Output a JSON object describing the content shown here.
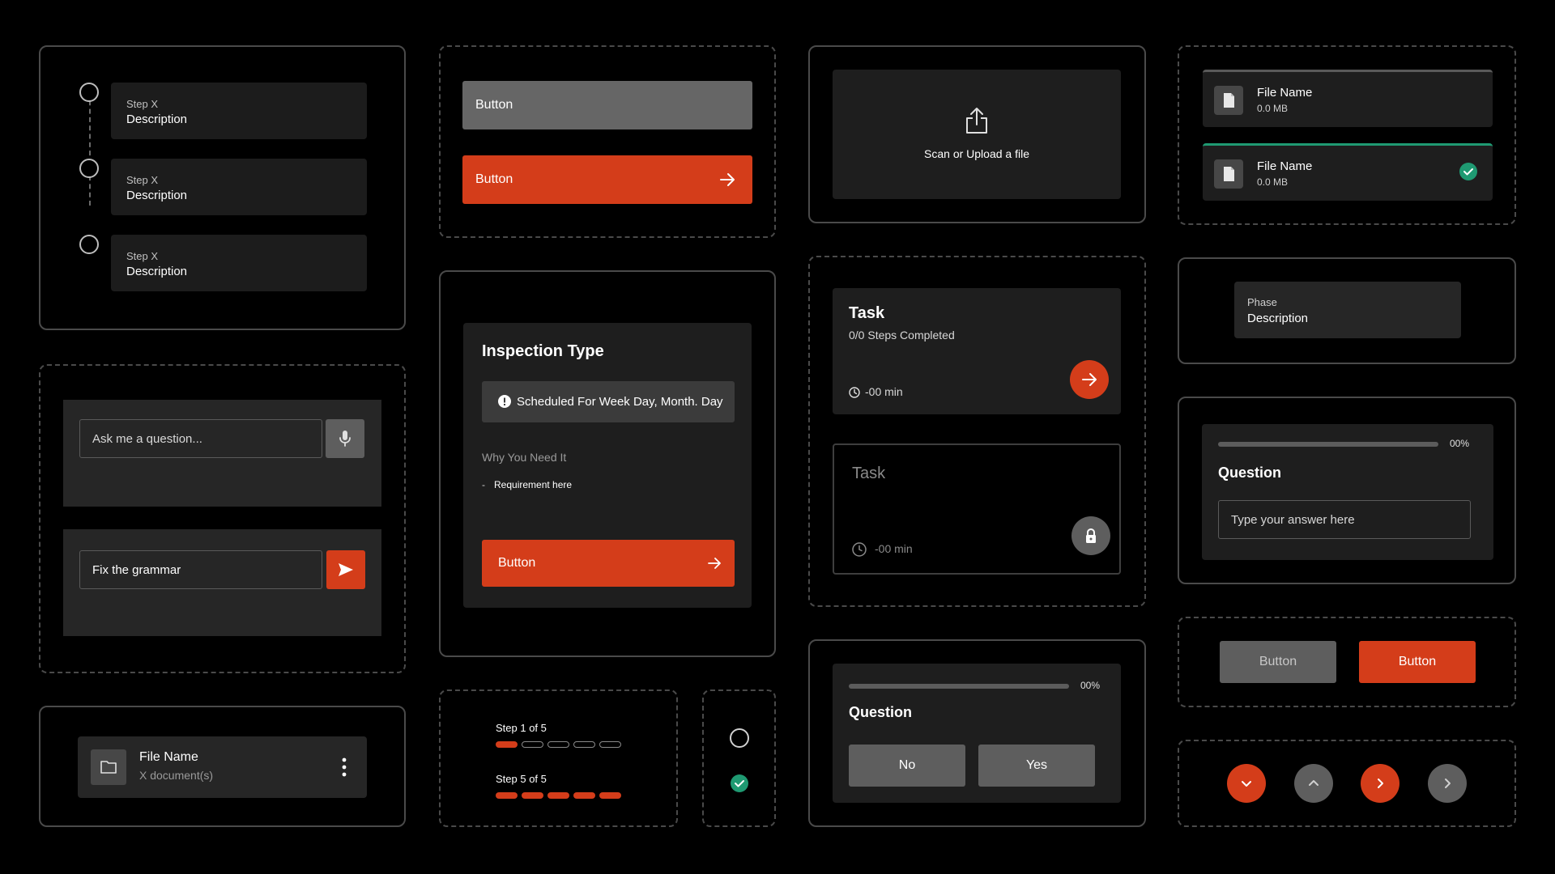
{
  "stepper": {
    "steps": [
      {
        "label": "Step X",
        "description": "Description"
      },
      {
        "label": "Step X",
        "description": "Description"
      },
      {
        "label": "Step X",
        "description": "Description"
      }
    ]
  },
  "buttons_top": {
    "disabled_label": "Button",
    "primary_label": "Button"
  },
  "upload": {
    "label": "Scan or Upload a file"
  },
  "files": [
    {
      "name": "File Name",
      "size": "0.0 MB"
    },
    {
      "name": "File Name",
      "size": "0.0 MB"
    }
  ],
  "chat": {
    "ask_placeholder": "Ask me a question...",
    "fix_value": "Fix the grammar"
  },
  "inspection": {
    "title": "Inspection Type",
    "scheduled": "Scheduled For Week Day, Month. Day",
    "why_label": "Why You Need It",
    "requirement_dash": "-",
    "requirement": "Requirement here",
    "button_label": "Button"
  },
  "task_active": {
    "title": "Task",
    "subtitle": "0/0 Steps Completed",
    "time": "-00 min"
  },
  "task_locked": {
    "title": "Task",
    "time": "-00 min"
  },
  "phase": {
    "label": "Phase",
    "description": "Description"
  },
  "question_text": {
    "progress_percent": 0,
    "progress_label": "00%",
    "title": "Question",
    "answer_placeholder": "Type your answer here"
  },
  "folder": {
    "name": "File Name",
    "count": "X document(s)"
  },
  "progress_steps": {
    "first": {
      "label": "Step 1 of 5",
      "done": 1,
      "total": 5
    },
    "second": {
      "label": "Step 5 of 5",
      "done": 5,
      "total": 5
    }
  },
  "question_yn": {
    "progress_percent": 0,
    "progress_label": "00%",
    "title": "Question",
    "no_label": "No",
    "yes_label": "Yes"
  },
  "button_pair": {
    "secondary_label": "Button",
    "primary_label": "Button"
  },
  "colors": {
    "accent": "#d43d1a",
    "success": "#1f9a72",
    "card": "#1e1e1e",
    "gray_button": "#606060"
  }
}
